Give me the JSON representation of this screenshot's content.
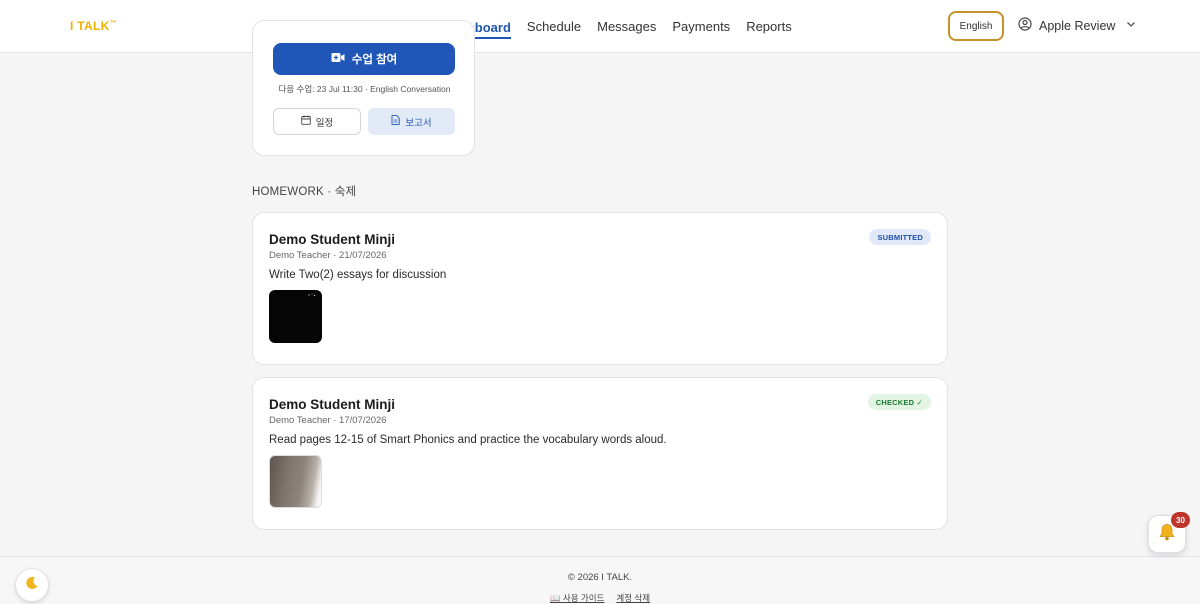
{
  "header": {
    "logo": "I TALK",
    "logo_mark": "™",
    "nav": [
      {
        "label": "Dashboard",
        "active": true
      },
      {
        "label": "Schedule",
        "active": false
      },
      {
        "label": "Messages",
        "active": false
      },
      {
        "label": "Payments",
        "active": false
      },
      {
        "label": "Reports",
        "active": false
      }
    ],
    "language_button": "English",
    "user_name": "Apple Review"
  },
  "lesson_card": {
    "join_button": "수업 참여",
    "next_lesson": "다음 수업: 23 Jul 11:30 · English Conversation",
    "schedule_button": "일정",
    "report_button": "보고서"
  },
  "homework_section_title": "HOMEWORK · 숙제",
  "homework": [
    {
      "student": "Demo Student Minji",
      "meta": "Demo Teacher · 21/07/2026",
      "description": "Write Two(2) essays for discussion",
      "status": "SUBMITTED"
    },
    {
      "student": "Demo Student Minji",
      "meta": "Demo Teacher · 17/07/2026",
      "description": "Read pages 12-15 of Smart Phonics and practice the vocabulary words aloud.",
      "status": "CHECKED ✓"
    }
  ],
  "footer": {
    "copyright": "© 2026 I TALK.",
    "guide_link": "📖 사용 가이드",
    "delete_account_link": "계정 삭제"
  },
  "notifications": {
    "count": "30"
  },
  "colors": {
    "accent": "#1f56b8",
    "logo": "#f1b100",
    "language_border": "#c8922a",
    "badge_alert": "#c0352b"
  },
  "icons": {
    "theme_toggle": "moon-icon",
    "notifications": "bell-icon",
    "user": "user-circle-icon",
    "join": "video-plus-icon"
  }
}
